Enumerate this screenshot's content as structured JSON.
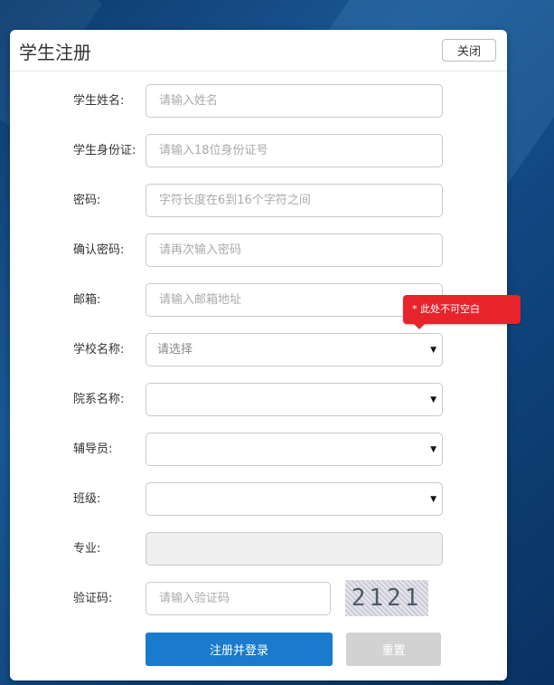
{
  "dialog": {
    "title": "学生注册",
    "close_label": "关闭"
  },
  "form": {
    "name": {
      "label": "学生姓名:",
      "placeholder": "请输入姓名"
    },
    "id_card": {
      "label": "学生身份证:",
      "placeholder": "请输入18位身份证号"
    },
    "password": {
      "label": "密码:",
      "placeholder": "字符长度在6到16个字符之间"
    },
    "confirm_password": {
      "label": "确认密码:",
      "placeholder": "请再次输入密码"
    },
    "email": {
      "label": "邮箱:",
      "placeholder": "请输入邮箱地址"
    },
    "school": {
      "label": "学校名称:",
      "value": "请选择"
    },
    "department": {
      "label": "院系名称:",
      "value": ""
    },
    "counselor": {
      "label": "辅导员:",
      "value": ""
    },
    "class": {
      "label": "班级:",
      "value": ""
    },
    "major": {
      "label": "专业:",
      "value": ""
    },
    "captcha": {
      "label": "验证码:",
      "placeholder": "请输入验证码",
      "image_text": "2121"
    }
  },
  "buttons": {
    "register": "注册并登录",
    "reset": "重置"
  },
  "tooltip": {
    "text": "* 此处不可空白",
    "color": "#e8232b"
  },
  "colors": {
    "primary": "#1a7acb",
    "background": "#1a5794"
  }
}
